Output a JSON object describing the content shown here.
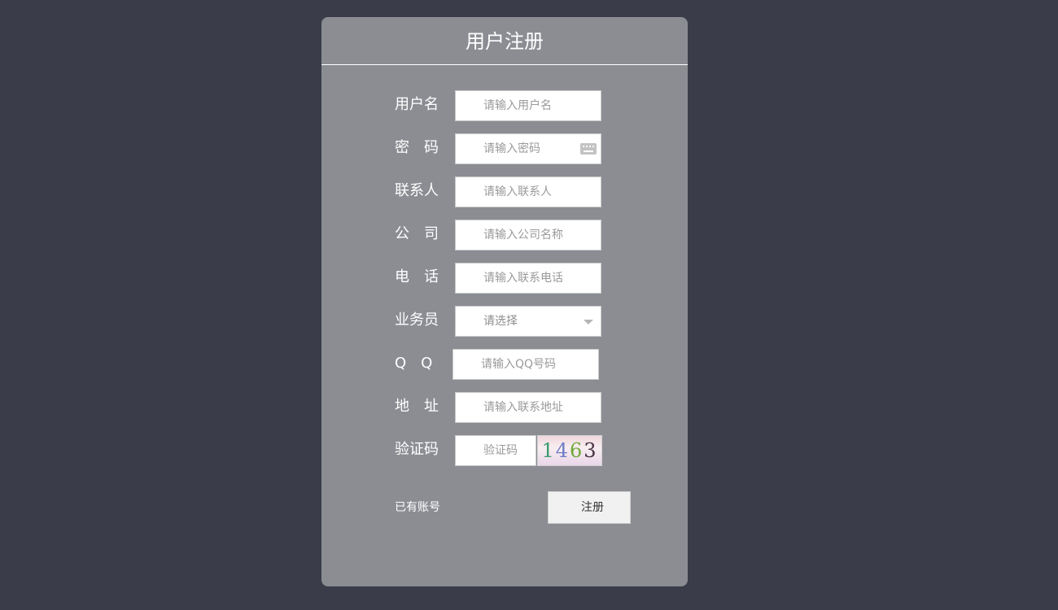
{
  "page": {
    "title": "用户注册"
  },
  "form": {
    "username": {
      "label": "用户名",
      "placeholder": "请输入用户名"
    },
    "password": {
      "label": "密　码",
      "placeholder": "请输入密码",
      "icon": "keyboard-icon"
    },
    "contact": {
      "label": "联系人",
      "placeholder": "请输入联系人"
    },
    "company": {
      "label": "公　司",
      "placeholder": "请输入公司名称"
    },
    "phone": {
      "label": "电　话",
      "placeholder": "请输入联系电话"
    },
    "salesperson": {
      "label": "业务员",
      "selected": "请选择"
    },
    "qq": {
      "label": "Q　Q",
      "placeholder": "请输入QQ号码"
    },
    "address": {
      "label": "地　址",
      "placeholder": "请输入联系地址"
    },
    "captcha": {
      "label": "验证码",
      "placeholder": "验证码",
      "code": [
        "1",
        "4",
        "6",
        "3"
      ]
    }
  },
  "footer": {
    "login_link": "已有账号",
    "register_label": "注册"
  },
  "colors": {
    "background": "#3a3d49",
    "panel": "#8b8d93",
    "text": "#ffffff"
  }
}
